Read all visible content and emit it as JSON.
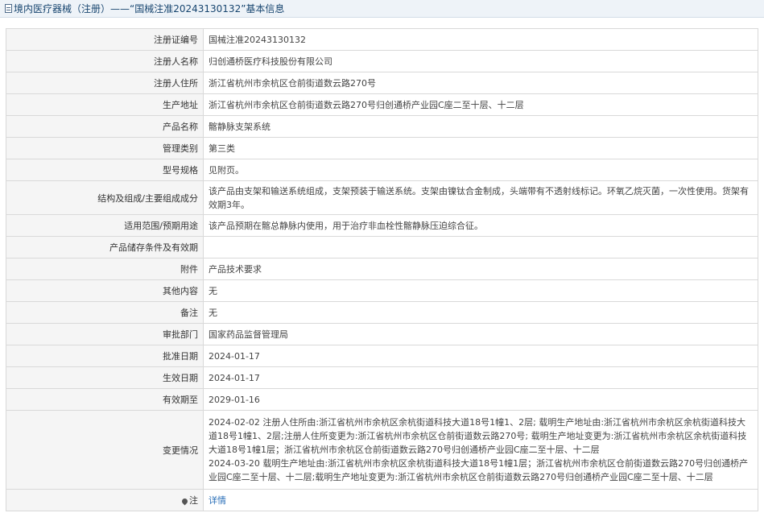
{
  "header": {
    "title": "境内医疗器械（注册）——“国械注准20243130132”基本信息",
    "icon": "document-icon"
  },
  "rows": [
    {
      "label": "注册证编号",
      "value": "国械注准20243130132"
    },
    {
      "label": "注册人名称",
      "value": "归创通桥医疗科技股份有限公司"
    },
    {
      "label": "注册人住所",
      "value": "浙江省杭州市余杭区仓前街道数云路270号"
    },
    {
      "label": "生产地址",
      "value": "浙江省杭州市余杭区仓前街道数云路270号归创通桥产业园C座二至十层、十二层"
    },
    {
      "label": "产品名称",
      "value": "髂静脉支架系统"
    },
    {
      "label": "管理类别",
      "value": "第三类"
    },
    {
      "label": "型号规格",
      "value": "见附页。"
    },
    {
      "label": "结构及组成/主要组成成分",
      "value": "该产品由支架和输送系统组成，支架预装于输送系统。支架由镍钛合金制成，头端带有不透射线标记。环氧乙烷灭菌，一次性使用。货架有效期3年。"
    },
    {
      "label": "适用范围/预期用途",
      "value": "该产品预期在髂总静脉内使用，用于治疗非血栓性髂静脉压迫综合征。"
    },
    {
      "label": "产品储存条件及有效期",
      "value": ""
    },
    {
      "label": "附件",
      "value": "产品技术要求"
    },
    {
      "label": "其他内容",
      "value": "无"
    },
    {
      "label": "备注",
      "value": "无"
    },
    {
      "label": "审批部门",
      "value": "国家药品监督管理局"
    },
    {
      "label": "批准日期",
      "value": "2024-01-17"
    },
    {
      "label": "生效日期",
      "value": "2024-01-17"
    },
    {
      "label": "有效期至",
      "value": "2029-01-16"
    },
    {
      "label": "变更情况",
      "value": "2024-02-02 注册人住所由:浙江省杭州市余杭区余杭街道科技大道18号1幢1、2层; 载明生产地址由:浙江省杭州市余杭区余杭街道科技大道18号1幢1、2层;注册人住所变更为:浙江省杭州市余杭区仓前街道数云路270号; 载明生产地址变更为:浙江省杭州市余杭区余杭街道科技大道18号1幢1层；浙江省杭州市余杭区仓前街道数云路270号归创通桥产业园C座二至十层、十二层\n2024-03-20 载明生产地址由:浙江省杭州市余杭区余杭街道科技大道18号1幢1层；浙江省杭州市余杭区仓前街道数云路270号归创通桥产业园C座二至十层、十二层;载明生产地址变更为:浙江省杭州市余杭区仓前街道数云路270号归创通桥产业园C座二至十层、十二层"
    }
  ],
  "footer": {
    "label": "注",
    "link": "详情",
    "icon": "pin-icon"
  }
}
